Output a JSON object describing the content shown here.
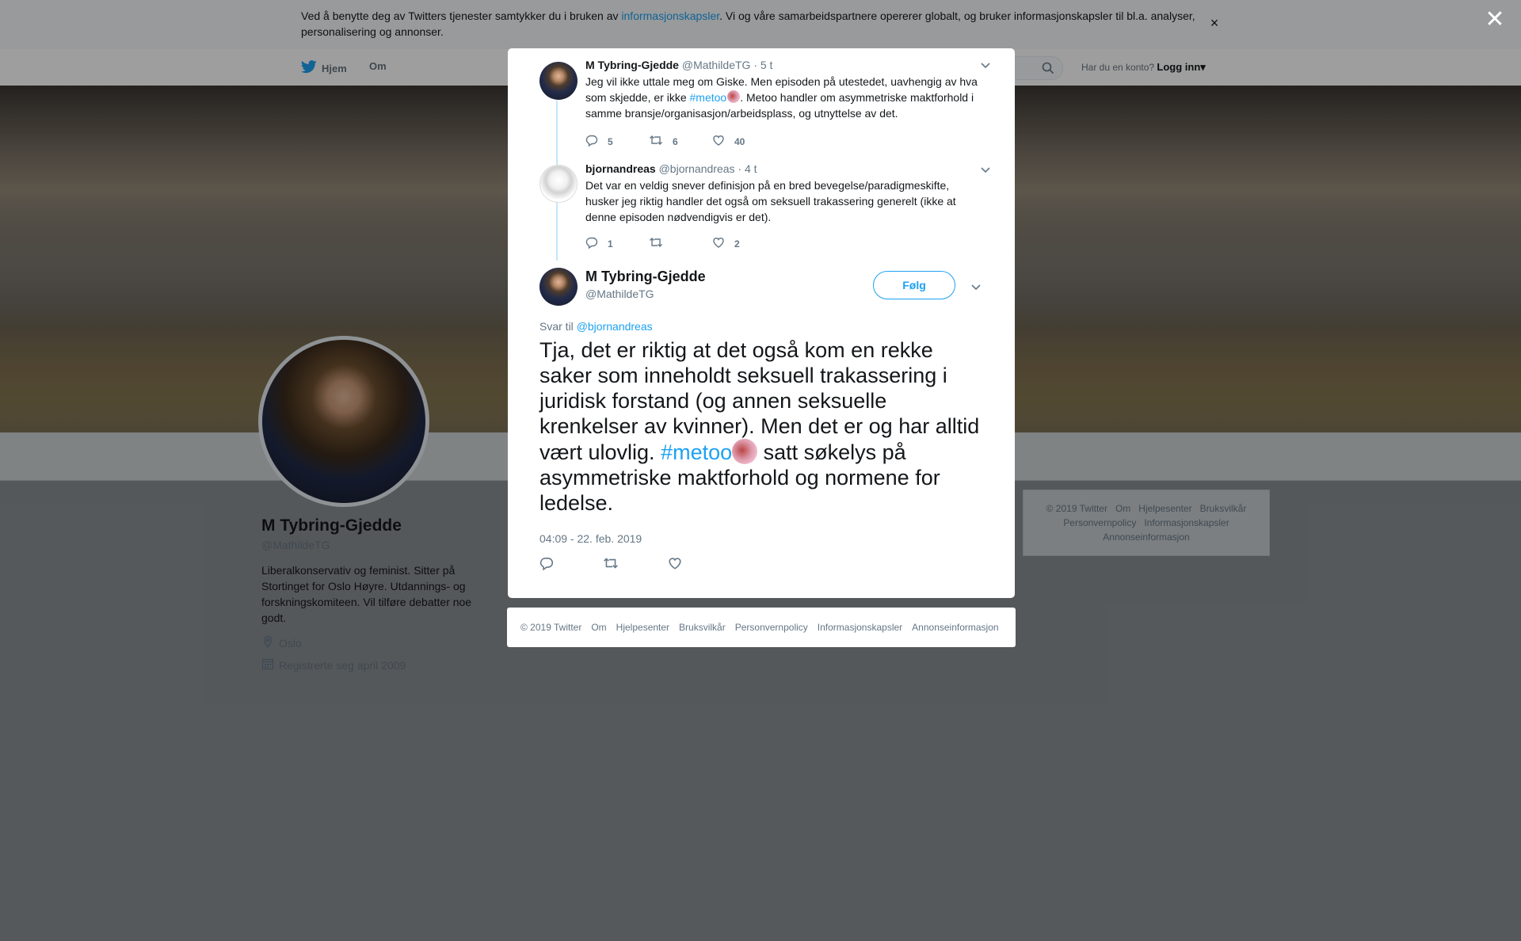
{
  "cookie_bar": {
    "text_before": "Ved å benytte deg av Twitters tjenester samtykker du i bruken av ",
    "link": "informasjonskapsler",
    "text_after": ". Vi og våre samarbeidspartnere opererer globalt, og bruker informasjonskapsler til bl.a. analyser, personalisering og annonser.",
    "close_glyph": "×"
  },
  "topnav": {
    "home": "Hjem",
    "about": "Om",
    "have_account": "Har du en konto?",
    "login": "Logg inn",
    "login_caret": "▾"
  },
  "profile": {
    "name": "M Tybring-Gjedde",
    "handle": "@MathildeTG",
    "bio": "Liberalkonservativ og feminist. Sitter på Stortinget for Oslo Høyre. Utdannings- og forskningskomiteen. Vil tilføre debatter noe godt.",
    "location": "Oslo",
    "joined": "Registrerte seg april 2009"
  },
  "side_footer": [
    "© 2019 Twitter",
    "Om",
    "Hjelpesenter",
    "Bruksvilkår",
    "Personvernpolicy",
    "Informasjonskapsler",
    "Annonseinformasjon"
  ],
  "overlay_close": "✕",
  "context_tweets": [
    {
      "name": "M Tybring-Gjedde",
      "handle": "@MathildeTG",
      "time": "· 5 t",
      "text_before": "Jeg vil ikke uttale meg om Giske. Men episoden på utestedet, uavhengig av hva som skjedde, er ikke ",
      "hashtag": "#metoo",
      "text_after": ". Metoo handler om asymmetriske maktforhold i samme bransje/organisasjon/arbeidsplass, og utnyttelse av det.",
      "replies": "5",
      "retweets": "6",
      "likes": "40"
    },
    {
      "name": "bjornandreas",
      "handle": "@bjornandreas",
      "time": "· 4 t",
      "text": "Det var en veldig snever definisjon på en bred bevegelse/paradigmeskifte, husker jeg riktig handler det også om seksuell trakassering generelt (ikke at denne episoden nødvendigvis er det).",
      "replies": "1",
      "retweets": "",
      "likes": "2"
    }
  ],
  "main_tweet": {
    "name": "M Tybring-Gjedde",
    "handle": "@MathildeTG",
    "follow": "Følg",
    "reply_to_label": "Svar til ",
    "reply_to_handle": "@bjornandreas",
    "text_before": "Tja, det er riktig at det også kom en rekke saker som inneholdt seksuell trakassering i juridisk forstand (og annen seksuelle krenkelser av kvinner). Men det er og har alltid vært ulovlig. ",
    "hashtag": "#metoo",
    "text_after": " satt søkelys på asymmetriske maktforhold og normene for ledelse.",
    "timestamp": "04:09 - 22. feb. 2019"
  },
  "modal_footer": [
    "© 2019 Twitter",
    "Om",
    "Hjelpesenter",
    "Bruksvilkår",
    "Personvernpolicy",
    "Informasjonskapsler",
    "Annonseinformasjon"
  ],
  "colors": {
    "accent": "#1da1f2",
    "text": "#14171a",
    "muted": "#657786",
    "thread": "#c4e7fb"
  },
  "icons": [
    "twitter-bird-icon",
    "search-icon",
    "location-icon",
    "calendar-icon",
    "reply-icon",
    "retweet-icon",
    "heart-icon",
    "chevron-down-icon",
    "close-icon"
  ]
}
